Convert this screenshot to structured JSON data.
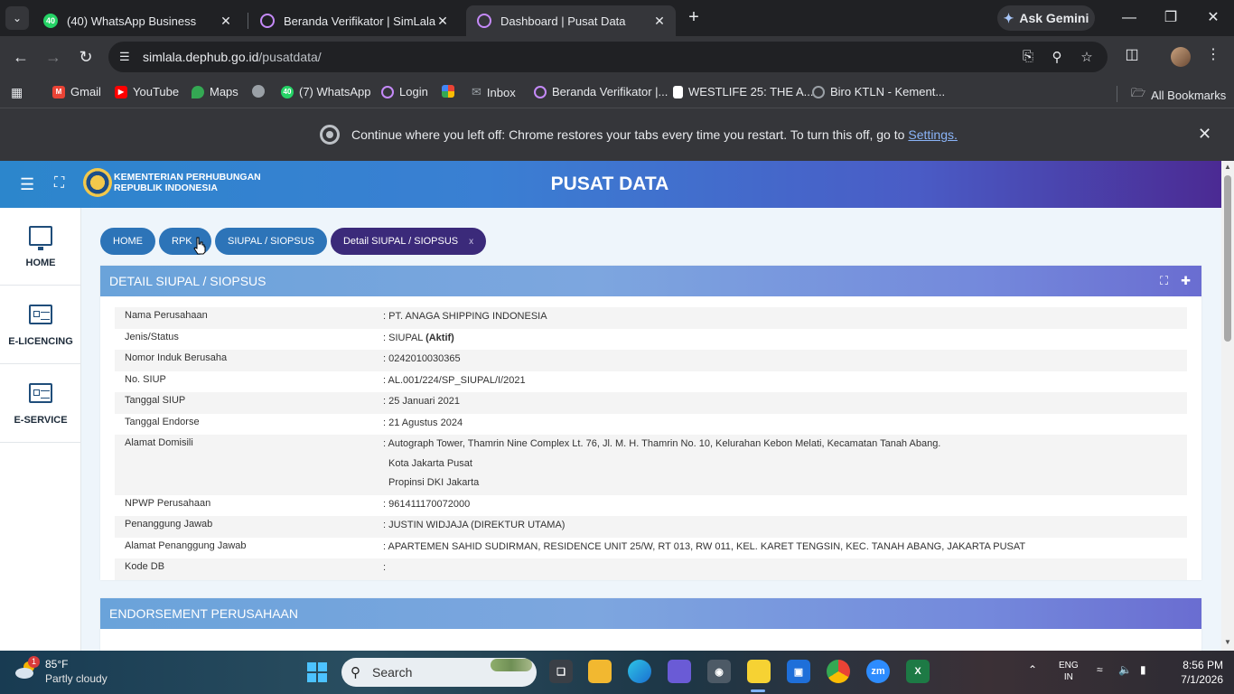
{
  "browser": {
    "tabs": [
      {
        "title": "(40) WhatsApp Business",
        "icon": "whatsapp-icon",
        "badge": "40"
      },
      {
        "title": "Beranda Verifikator | SimLala",
        "icon": "globe-icon"
      },
      {
        "title": "Dashboard | Pusat Data",
        "icon": "globe-icon"
      }
    ],
    "gemini_label": "Ask Gemini",
    "url_host": "simlala.dephub.go.id",
    "url_path": "/pusatdata/",
    "bookmarks": [
      {
        "label": "Gmail",
        "icon": "gmail-icon",
        "color": "#ea4335"
      },
      {
        "label": "YouTube",
        "icon": "youtube-icon",
        "color": "#ff0000"
      },
      {
        "label": "Maps",
        "icon": "maps-icon",
        "color": "#34a853"
      },
      {
        "label": "",
        "icon": "globe-icon",
        "color": "#9aa0a6"
      },
      {
        "label": "(7) WhatsApp",
        "icon": "whatsapp-icon",
        "color": "#25d366"
      },
      {
        "label": "Login",
        "icon": "globe-icon",
        "color": "#b06ab3"
      },
      {
        "label": "",
        "icon": "pinwheel-icon",
        "color": "#f4b400"
      },
      {
        "label": "Inbox",
        "icon": "mail-icon",
        "color": "#9aa0a6"
      },
      {
        "label": "Beranda Verifikator |...",
        "icon": "globe-icon",
        "color": "#b06ab3"
      },
      {
        "label": "WESTLIFE 25: THE A...",
        "icon": "page-icon",
        "color": "#ffffff"
      },
      {
        "label": "Biro KTLN - Kement...",
        "icon": "globe-icon",
        "color": "#9aa0a6"
      }
    ],
    "all_bookmarks": "All Bookmarks",
    "infobar_text": "Continue where you left off: Chrome restores your tabs every time you restart. To turn this off, go to",
    "infobar_link": "Settings."
  },
  "app": {
    "org_line1": "KEMENTERIAN PERHUBUNGAN",
    "org_line2": "REPUBLIK INDONESIA",
    "title": "PUSAT DATA",
    "sidebar": [
      {
        "label": "HOME",
        "icon": "monitor-icon"
      },
      {
        "label": "E-LICENCING",
        "icon": "card-icon"
      },
      {
        "label": "E-SERVICE",
        "icon": "card-icon"
      }
    ],
    "breadcrumbs": [
      "HOME",
      "RPK",
      "SIUPAL / SIOPSUS",
      "Detail SIUPAL / SIOPSUS"
    ],
    "breadcrumb_close": "x"
  },
  "detail": {
    "title": "DETAIL SIUPAL / SIOPSUS",
    "rows": [
      {
        "label": "Nama Perusahaan",
        "value": ": PT. ANAGA SHIPPING INDONESIA"
      },
      {
        "label": "Jenis/Status",
        "value": ": SIUPAL ",
        "bold": "(Aktif)"
      },
      {
        "label": "Nomor Induk Berusaha",
        "value": ": 0242010030365"
      },
      {
        "label": "No. SIUP",
        "value": ": AL.001/224/SP_SIUPAL/I/2021"
      },
      {
        "label": "Tanggal SIUP",
        "value": ": 25 Januari 2021"
      },
      {
        "label": "Tanggal Endorse",
        "value": ": 21 Agustus 2024"
      },
      {
        "label": "Alamat Domisili",
        "value": ": Autograph Tower, Thamrin Nine Complex Lt. 76, Jl. M. H. Thamrin No. 10, Kelurahan Kebon Melati, Kecamatan Tanah Abang.",
        "line2": "Kota Jakarta Pusat",
        "line3": "Propinsi DKI Jakarta"
      },
      {
        "label": "NPWP Perusahaan",
        "value": ": 961411170072000"
      },
      {
        "label": "Penanggung Jawab",
        "value": ": JUSTIN WIDJAJA (DIREKTUR UTAMA)"
      },
      {
        "label": "Alamat Penanggung Jawab",
        "value": ": APARTEMEN SAHID SUDIRMAN, RESIDENCE UNIT 25/W, RT 013, RW 011, KEL. KARET TENGSIN, KEC. TANAH ABANG, JAKARTA PUSAT"
      },
      {
        "label": "Kode DB",
        "value": ":"
      }
    ]
  },
  "endorsement": {
    "title": "ENDORSEMENT PERUSAHAAN"
  },
  "taskbar": {
    "notification_count": "1",
    "temperature": "85°F",
    "weather": "Partly cloudy",
    "search_placeholder": "Search",
    "lang_line1": "ENG",
    "lang_line2": "IN",
    "time": "8:56 PM",
    "date": "7/1/2026"
  }
}
